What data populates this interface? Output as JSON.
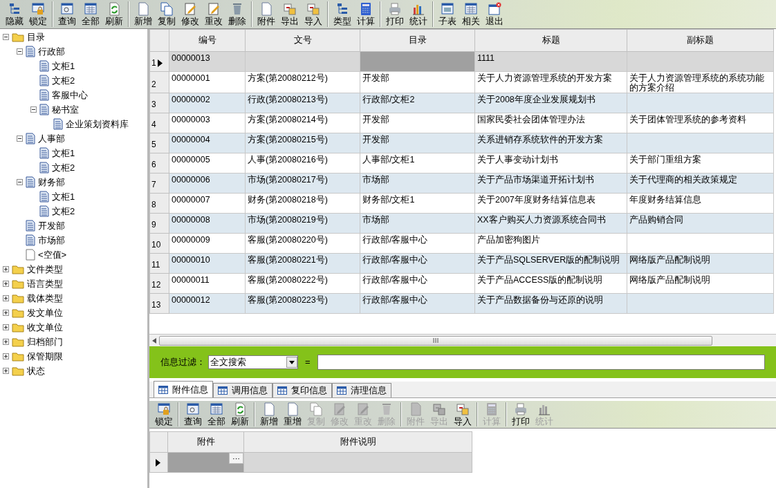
{
  "toolbar": {
    "groups": [
      [
        {
          "label": "隐藏",
          "kind": "tree",
          "disabled": false
        },
        {
          "label": "锁定",
          "kind": "lock",
          "disabled": false
        }
      ],
      [
        {
          "label": "查询",
          "kind": "query",
          "disabled": false
        },
        {
          "label": "全部",
          "kind": "grid",
          "disabled": false
        },
        {
          "label": "刷新",
          "kind": "refresh",
          "disabled": false
        }
      ],
      [
        {
          "label": "新增",
          "kind": "page",
          "disabled": false
        },
        {
          "label": "复制",
          "kind": "copy",
          "disabled": false
        },
        {
          "label": "修改",
          "kind": "edit",
          "disabled": false
        },
        {
          "label": "重改",
          "kind": "edit",
          "disabled": false
        },
        {
          "label": "删除",
          "kind": "trash",
          "disabled": false
        }
      ],
      [
        {
          "label": "附件",
          "kind": "page",
          "disabled": false
        },
        {
          "label": "导出",
          "kind": "transfer",
          "disabled": false
        },
        {
          "label": "导入",
          "kind": "transfer",
          "disabled": false
        }
      ],
      [
        {
          "label": "类型",
          "kind": "tree",
          "disabled": false
        },
        {
          "label": "计算",
          "kind": "calc",
          "disabled": false
        }
      ],
      [
        {
          "label": "打印",
          "kind": "print",
          "disabled": false
        },
        {
          "label": "统计",
          "kind": "chart",
          "disabled": false
        }
      ],
      [
        {
          "label": "子表",
          "kind": "window",
          "disabled": false
        },
        {
          "label": "相关",
          "kind": "grid",
          "disabled": false
        },
        {
          "label": "退出",
          "kind": "exit",
          "disabled": false
        }
      ]
    ]
  },
  "tree": [
    {
      "label": "目录",
      "kind": "folder",
      "expanded": true,
      "children": [
        {
          "label": "行政部",
          "kind": "doc",
          "expanded": true,
          "children": [
            {
              "label": "文柜1",
              "kind": "doc"
            },
            {
              "label": "文柜2",
              "kind": "doc"
            },
            {
              "label": "客服中心",
              "kind": "doc"
            },
            {
              "label": "秘书室",
              "kind": "doc",
              "expanded": true,
              "children": [
                {
                  "label": "企业策划资料库",
                  "kind": "doc"
                }
              ]
            }
          ]
        },
        {
          "label": "人事部",
          "kind": "doc",
          "expanded": true,
          "children": [
            {
              "label": "文柜1",
              "kind": "doc"
            },
            {
              "label": "文柜2",
              "kind": "doc"
            }
          ]
        },
        {
          "label": "财务部",
          "kind": "doc",
          "expanded": true,
          "children": [
            {
              "label": "文柜1",
              "kind": "doc"
            },
            {
              "label": "文柜2",
              "kind": "doc"
            }
          ]
        },
        {
          "label": "开发部",
          "kind": "doc"
        },
        {
          "label": "市场部",
          "kind": "doc"
        },
        {
          "label": "<空值>",
          "kind": "blank"
        }
      ]
    },
    {
      "label": "文件类型",
      "kind": "folder",
      "expanded": false
    },
    {
      "label": "语言类型",
      "kind": "folder",
      "expanded": false
    },
    {
      "label": "载体类型",
      "kind": "folder",
      "expanded": false
    },
    {
      "label": "发文单位",
      "kind": "folder",
      "expanded": false
    },
    {
      "label": "收文单位",
      "kind": "folder",
      "expanded": false
    },
    {
      "label": "归档部门",
      "kind": "folder",
      "expanded": false
    },
    {
      "label": "保管期限",
      "kind": "folder",
      "expanded": false
    },
    {
      "label": "状态",
      "kind": "folder",
      "expanded": false
    }
  ],
  "table": {
    "columns": [
      "编号",
      "文号",
      "目录",
      "标题",
      "副标题"
    ],
    "rows": [
      {
        "index": "1",
        "selected": true,
        "number": "00000013",
        "title": "1111"
      },
      {
        "index": "2",
        "selected": false,
        "number": "00000001",
        "doc_no": "方案(第20080212号)",
        "directory": "开发部",
        "title": "关于人力资源管理系统的开发方案",
        "subtitle": "关于人力资源管理系统的系统功能的方案介绍"
      },
      {
        "index": "3",
        "selected": false,
        "number": "00000002",
        "doc_no": "行政(第20080213号)",
        "directory": "行政部/文柜2",
        "title": "关于2008年度企业发展规划书"
      },
      {
        "index": "4",
        "selected": false,
        "number": "00000003",
        "doc_no": "方案(第20080214号)",
        "directory": "开发部",
        "title": "国家民委社会团体管理办法",
        "subtitle": "关于团体管理系统的参考资料"
      },
      {
        "index": "5",
        "selected": false,
        "number": "00000004",
        "doc_no": "方案(第20080215号)",
        "directory": "开发部",
        "title": "关系进销存系统软件的开发方案"
      },
      {
        "index": "6",
        "selected": false,
        "number": "00000005",
        "doc_no": "人事(第20080216号)",
        "directory": "人事部/文柜1",
        "title": "关于人事变动计划书",
        "subtitle": "关于部门重组方案"
      },
      {
        "index": "7",
        "selected": false,
        "number": "00000006",
        "doc_no": "市场(第20080217号)",
        "directory": "市场部",
        "title": "关于产品市场渠道开拓计划书",
        "subtitle": "关于代理商的相关政策规定"
      },
      {
        "index": "8",
        "selected": false,
        "number": "00000007",
        "doc_no": "财务(第20080218号)",
        "directory": "财务部/文柜1",
        "title": "关于2007年度财务结算信息表",
        "subtitle": "年度财务结算信息"
      },
      {
        "index": "9",
        "selected": false,
        "number": "00000008",
        "doc_no": "市场(第20080219号)",
        "directory": "市场部",
        "title": "XX客户购买人力资源系统合同书",
        "subtitle": "产品购销合同"
      },
      {
        "index": "10",
        "selected": false,
        "number": "00000009",
        "doc_no": "客服(第20080220号)",
        "directory": "行政部/客服中心",
        "title": "产品加密狗图片"
      },
      {
        "index": "11",
        "selected": false,
        "number": "00000010",
        "doc_no": "客服(第20080221号)",
        "directory": "行政部/客服中心",
        "title": "关于产品SQLSERVER版的配制说明",
        "subtitle": "网络版产品配制说明"
      },
      {
        "index": "12",
        "selected": false,
        "number": "00000011",
        "doc_no": "客服(第20080222号)",
        "directory": "行政部/客服中心",
        "title": "关于产品ACCESS版的配制说明",
        "subtitle": "网络版产品配制说明"
      },
      {
        "index": "13",
        "selected": false,
        "number": "00000012",
        "doc_no": "客服(第20080223号)",
        "directory": "行政部/客服中心",
        "title": "关于产品数据备份与还原的说明"
      }
    ]
  },
  "filter": {
    "label": "信息过滤：",
    "field": "全文搜索",
    "operator": "="
  },
  "tabs": [
    {
      "label": "附件信息",
      "selected": true
    },
    {
      "label": "调用信息",
      "selected": false
    },
    {
      "label": "复印信息",
      "selected": false
    },
    {
      "label": "清理信息",
      "selected": false
    }
  ],
  "sub_toolbar": {
    "groups": [
      [
        {
          "label": "锁定",
          "kind": "lock",
          "disabled": false
        }
      ],
      [
        {
          "label": "查询",
          "kind": "query",
          "disabled": false
        },
        {
          "label": "全部",
          "kind": "grid",
          "disabled": false
        },
        {
          "label": "刷新",
          "kind": "refresh",
          "disabled": false
        }
      ],
      [
        {
          "label": "新增",
          "kind": "page",
          "disabled": false
        },
        {
          "label": "重增",
          "kind": "page",
          "disabled": false
        },
        {
          "label": "复制",
          "kind": "copy",
          "disabled": true
        },
        {
          "label": "修改",
          "kind": "edit",
          "disabled": true
        },
        {
          "label": "重改",
          "kind": "edit",
          "disabled": true
        },
        {
          "label": "删除",
          "kind": "trash",
          "disabled": true
        }
      ],
      [
        {
          "label": "附件",
          "kind": "page",
          "disabled": true
        },
        {
          "label": "导出",
          "kind": "transfer",
          "disabled": true
        },
        {
          "label": "导入",
          "kind": "transfer",
          "disabled": false
        }
      ],
      [
        {
          "label": "计算",
          "kind": "calc",
          "disabled": true
        }
      ],
      [
        {
          "label": "打印",
          "kind": "print",
          "disabled": false
        },
        {
          "label": "统计",
          "kind": "chart",
          "disabled": true
        }
      ]
    ]
  },
  "sub_table": {
    "columns": [
      "附件",
      "附件说明"
    ],
    "rows": [
      {
        "selected": true,
        "ellipsis_button": "···"
      }
    ]
  }
}
